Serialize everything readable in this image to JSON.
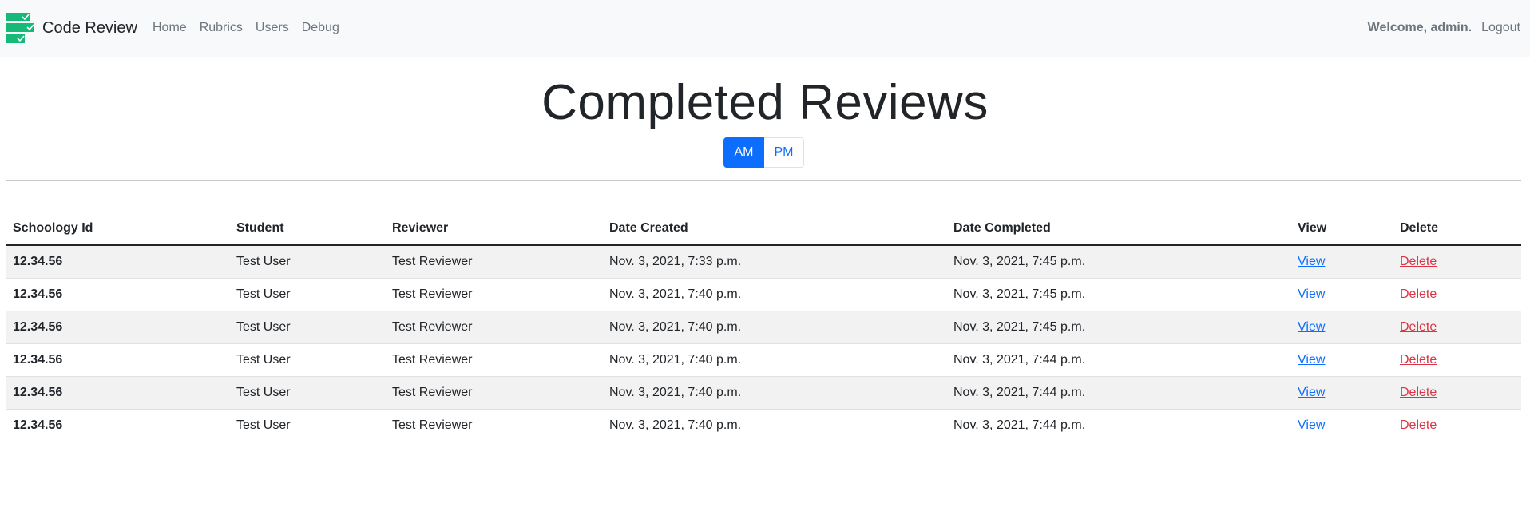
{
  "navbar": {
    "brand": "Code Review",
    "links": [
      "Home",
      "Rubrics",
      "Users",
      "Debug"
    ],
    "welcome": "Welcome, admin.",
    "logout": "Logout"
  },
  "page": {
    "title": "Completed Reviews",
    "toggle": {
      "am": "AM",
      "pm": "PM",
      "selected": "AM"
    }
  },
  "table": {
    "headers": [
      "Schoology Id",
      "Student",
      "Reviewer",
      "Date Created",
      "Date Completed",
      "View",
      "Delete"
    ],
    "rows": [
      {
        "schoology_id": "12.34.56",
        "student": "Test User",
        "reviewer": "Test Reviewer",
        "date_created": "Nov. 3, 2021, 7:33 p.m.",
        "date_completed": "Nov. 3, 2021, 7:45 p.m.",
        "view": "View",
        "delete": "Delete"
      },
      {
        "schoology_id": "12.34.56",
        "student": "Test User",
        "reviewer": "Test Reviewer",
        "date_created": "Nov. 3, 2021, 7:40 p.m.",
        "date_completed": "Nov. 3, 2021, 7:45 p.m.",
        "view": "View",
        "delete": "Delete"
      },
      {
        "schoology_id": "12.34.56",
        "student": "Test User",
        "reviewer": "Test Reviewer",
        "date_created": "Nov. 3, 2021, 7:40 p.m.",
        "date_completed": "Nov. 3, 2021, 7:45 p.m.",
        "view": "View",
        "delete": "Delete"
      },
      {
        "schoology_id": "12.34.56",
        "student": "Test User",
        "reviewer": "Test Reviewer",
        "date_created": "Nov. 3, 2021, 7:40 p.m.",
        "date_completed": "Nov. 3, 2021, 7:44 p.m.",
        "view": "View",
        "delete": "Delete"
      },
      {
        "schoology_id": "12.34.56",
        "student": "Test User",
        "reviewer": "Test Reviewer",
        "date_created": "Nov. 3, 2021, 7:40 p.m.",
        "date_completed": "Nov. 3, 2021, 7:44 p.m.",
        "view": "View",
        "delete": "Delete"
      },
      {
        "schoology_id": "12.34.56",
        "student": "Test User",
        "reviewer": "Test Reviewer",
        "date_created": "Nov. 3, 2021, 7:40 p.m.",
        "date_completed": "Nov. 3, 2021, 7:44 p.m.",
        "view": "View",
        "delete": "Delete"
      }
    ]
  },
  "colors": {
    "primary": "#0d6efd",
    "danger": "#dc3545",
    "navbar_bg": "#f8f9fa",
    "logo_green": "#17b978"
  },
  "icons": {
    "logo": "code-review-logo-icon"
  }
}
